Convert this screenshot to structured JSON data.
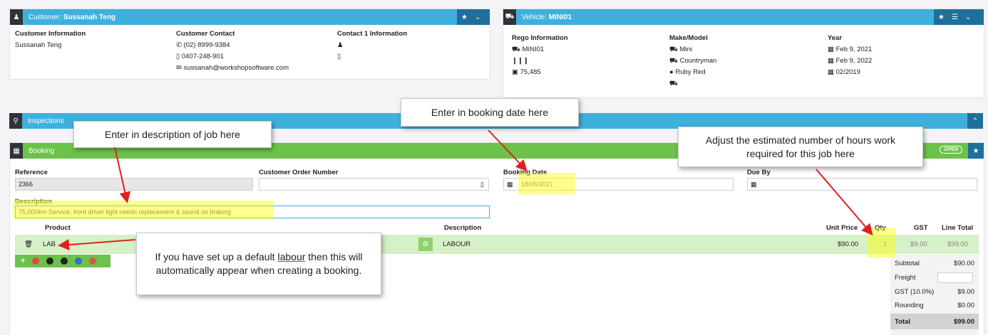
{
  "customer": {
    "bar_prefix": "Customer:",
    "bar_name": "Sussanah Teng",
    "info_heading": "Customer Information",
    "info_name": "Sussanah Teng",
    "contact_heading": "Customer Contact",
    "phone": "(02) 8999-9384",
    "mobile": "0407-248-901",
    "email": "sussanah@workshopsoftware.com",
    "contact1_heading": "Contact 1 Information"
  },
  "vehicle": {
    "bar_prefix": "Vehicle:",
    "bar_name": "MINI01",
    "rego_heading": "Rego Information",
    "rego": "MINI01",
    "odometer": "75,485",
    "make_heading": "Make/Model",
    "make": "Mini",
    "model": "Countryman",
    "color": "Ruby Red",
    "year_heading": "Year",
    "date1": "Feb 9, 2021",
    "date2": "Feb 9, 2022",
    "date3": "02/2019"
  },
  "inspections": {
    "label": "Inspections"
  },
  "booking": {
    "label": "Booking",
    "status": "OPEN",
    "reference_label": "Reference",
    "reference_value": "2366",
    "order_label": "Customer  Order Number",
    "order_value": "",
    "date_label": "Booking Date",
    "date_value": "18/06/2021",
    "due_label": "Due By",
    "due_value": "",
    "description_label": "Description",
    "description_value": "75,000km Service, front driver light needs replacement & sound on braking"
  },
  "lines": {
    "headers": {
      "product": "Product",
      "description": "Description",
      "unit_price": "Unit Price",
      "qty": "Qty",
      "gst": "GST",
      "line_total": "Line Total"
    },
    "row": {
      "product": "LAB",
      "description": "LABOUR",
      "unit_price": "$90.00",
      "qty": "1",
      "gst": "$9.00",
      "line_total": "$99.00"
    }
  },
  "totals": {
    "subtotal_label": "Subtotal",
    "subtotal": "$90.00",
    "freight_label": "Freight",
    "freight": "",
    "gst_label": "GST (10.0%)",
    "gst": "$9.00",
    "rounding_label": "Rounding",
    "rounding": "$0.00",
    "total_label": "Total",
    "total": "$99.00"
  },
  "callouts": {
    "description": "Enter in description of job here",
    "booking_date": "Enter in booking date here",
    "hours": "Adjust the estimated number of hours work required for this job here",
    "labour_1": "If you have set up a default",
    "labour_link": "labour",
    "labour_2": "then this will automatically appear when creating a booking."
  },
  "colors": {
    "blue_bar": "#3fb0db",
    "green_bar": "#6cc24a",
    "row_green": "#d6f0c8",
    "highlight": "#ffff00",
    "arrow": "#e02020"
  },
  "icons": [
    "user-icon",
    "car-icon",
    "star-icon",
    "chevron-down-icon",
    "list-icon",
    "search-icon",
    "chevron-up-icon",
    "calendar-icon",
    "trash-icon",
    "gear-icon",
    "plus-icon",
    "phone-icon",
    "mobile-icon",
    "envelope-icon",
    "barcode-icon",
    "binoculars-icon",
    "drop-icon"
  ]
}
